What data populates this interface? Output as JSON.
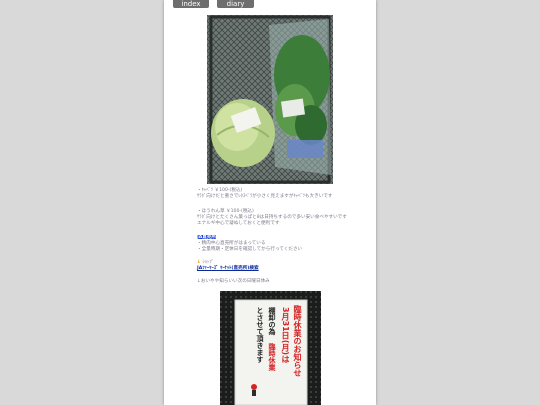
{
  "nav": {
    "index_label": "index",
    "diary_index_label": "diary index"
  },
  "produce": {
    "line1": "・ｷｬﾍﾞﾂ ￥100-(税込)",
    "line2": "ｻﾗﾀﾞ向けだと重さでﾚﾀｽﾍﾟﾗが小さく見えますがｷｬﾍﾞﾂも大きいです",
    "line3": "・ほうれん草 ￥100-(税込)",
    "line4": "ｻﾗﾀﾞ向けとたくさん葉っぱと8は日持ちするので多い安い食べやすいです",
    "line5": "エナルギ中心で凝ぬしておくと便利です"
  },
  "market": {
    "link_label": "JA直売所",
    "line1": "・精肉中心直売所がはまっている",
    "line2": "・全量時期・定休日を確認してから行ってください"
  },
  "links": {
    "arrow1": "↓",
    "link_prefix": "ｼｮｯﾌﾟ",
    "link2_label": "JAﾌｧｰﾏｰｽﾞ ﾏｰｹｯﾄ(直売所)検索"
  },
  "note": {
    "text": "↓おいやや知らいい次の日曜日休み"
  },
  "sign": {
    "title": "臨時休業のお知らせ",
    "date": "3月31日(月)は",
    "body1": "棚卸の為",
    "body2": "臨時休業",
    "body3": "とさせて頂きます"
  },
  "colors": {
    "link": "#0b2a9c",
    "highlight": "#1a3fd0",
    "sign_red": "#d42323",
    "text": "#7a7a8a"
  }
}
